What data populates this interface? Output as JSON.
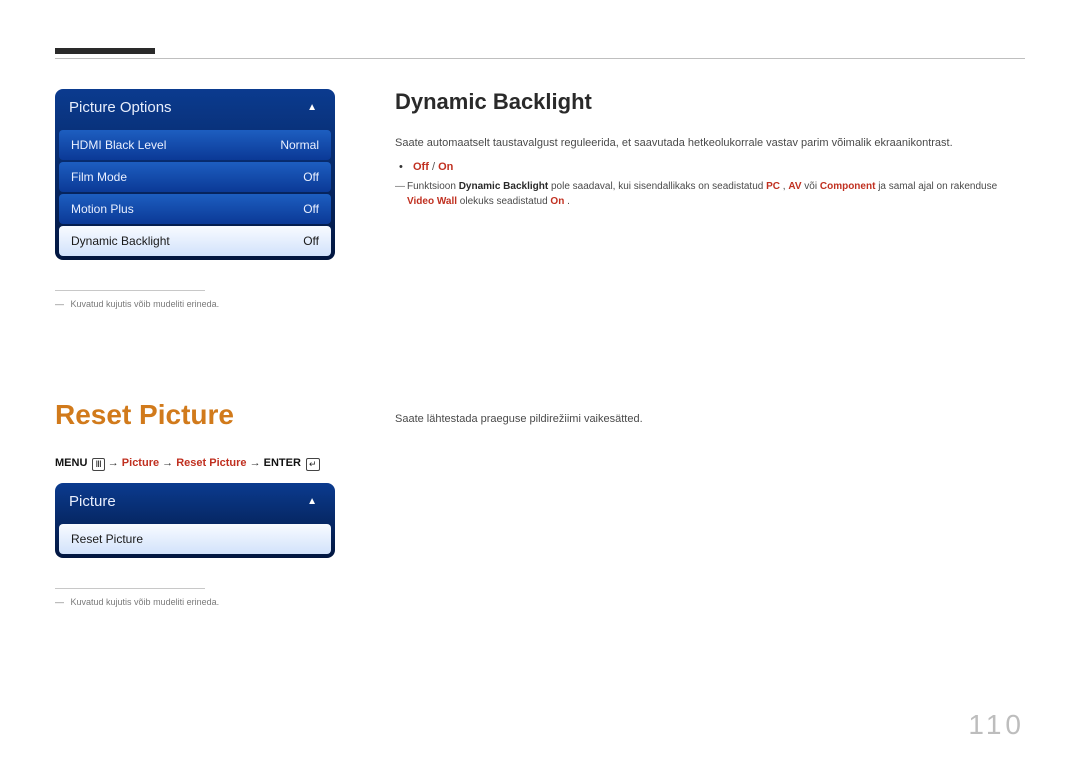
{
  "page_number": "110",
  "section1": {
    "menu_title": "Picture Options",
    "rows": [
      {
        "label": "HDMI Black Level",
        "value": "Normal",
        "selected": false
      },
      {
        "label": "Film Mode",
        "value": "Off",
        "selected": false
      },
      {
        "label": "Motion Plus",
        "value": "Off",
        "selected": false
      },
      {
        "label": "Dynamic Backlight",
        "value": "Off",
        "selected": true
      }
    ],
    "footnote": "Kuvatud kujutis võib mudeliti erineda.",
    "heading": "Dynamic Backlight",
    "description": "Saate automaatselt taustavalgust reguleerida, et saavutada hetkeolukorrale vastav parim võimalik ekraanikontrast.",
    "option_off": "Off",
    "option_on": "On",
    "note_parts": {
      "pre": "Funktsioon ",
      "dbl": "Dynamic Backlight",
      "mid1": " pole saadaval, kui sisendallikaks on seadistatud ",
      "pc": "PC",
      "comma": ", ",
      "av": "AV",
      "mid2": " või ",
      "comp": "Component",
      "mid3": "  ja samal ajal on rakenduse ",
      "vw": "Video Wall",
      "mid4": " olekuks seadistatud ",
      "on2": "On",
      "end": "."
    }
  },
  "section2": {
    "heading": "Reset Picture",
    "description": "Saate lähtestada praeguse pildirežiimi vaikesätted.",
    "breadcrumb": {
      "menu": "MENU",
      "picture": "Picture",
      "reset": "Reset Picture",
      "enter": "ENTER"
    },
    "menu_title": "Picture",
    "rows": [
      {
        "label": "Reset Picture",
        "value": "",
        "selected": true
      }
    ],
    "footnote": "Kuvatud kujutis võib mudeliti erineda."
  }
}
